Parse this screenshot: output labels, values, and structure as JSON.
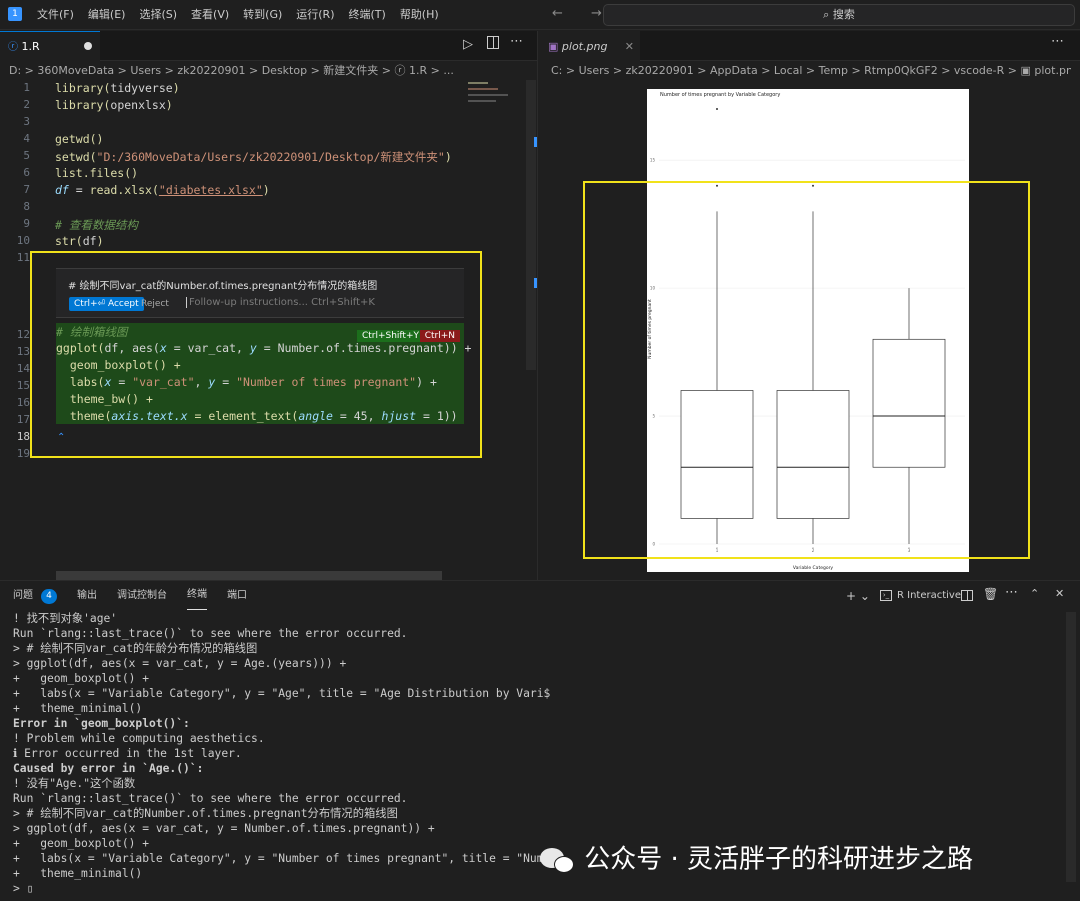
{
  "titlebar": {
    "logo": "1",
    "menu": [
      "文件(F)",
      "编辑(E)",
      "选择(S)",
      "查看(V)",
      "转到(G)",
      "运行(R)",
      "终端(T)",
      "帮助(H)"
    ],
    "nav": "← →",
    "search": "⌕ 搜索"
  },
  "editor": {
    "tab_label": "1.R",
    "breadcrumb": "D: > 360MoveData > Users > zk20220901 > Desktop > 新建文件夹 > ⓡ 1.R > ...",
    "line_numbers": [
      "1",
      "2",
      "3",
      "4",
      "5",
      "6",
      "7",
      "8",
      "9",
      "10",
      "11",
      "12",
      "13",
      "14",
      "15",
      "16",
      "17",
      "18",
      "19"
    ],
    "lines": {
      "l1a": "library(",
      "l1b": "tidyverse",
      "l1c": ")",
      "l2a": "library(",
      "l2b": "openxlsx",
      "l2c": ")",
      "l4": "getwd()",
      "l5a": "setwd(",
      "l5b": "\"D:/360MoveData/Users/zk20220901/Desktop/新建文件夹\"",
      "l5c": ")",
      "l6": "list.files()",
      "l7a": "df",
      "l7b": " = ",
      "l7c": "read.xlsx(",
      "l7d": "\"diabetes.xlsx\"",
      "l7e": ")",
      "l9": "# 查看数据结构",
      "l10a": "str(",
      "l10b": "df",
      "l10c": ")"
    },
    "chat": {
      "prompt": "# 绘制不同var_cat的Number.of.times.pregnant分布情况的箱线图",
      "accept": "Ctrl+⏎ Accept",
      "reject": "Reject",
      "followup": "Follow-up instructions... Ctrl+Shift+K",
      "accept_key": "Ctrl+Shift+Y",
      "reject_key": "Ctrl+N"
    },
    "diff_lines": {
      "d1": "# 绘制箱线图",
      "d2a": "ggplot(",
      "d2b": "df, aes(",
      "d2c": "x",
      "d2d": " = var_cat, ",
      "d2e": "y",
      "d2f": " = Number.of.times.pregnant)) +",
      "d3": "  geom_boxplot() +",
      "d4a": "  labs(",
      "d4b": "x",
      "d4c": " = ",
      "d4d": "\"var_cat\"",
      "d4e": ", ",
      "d4f": "y",
      "d4g": " = ",
      "d4h": "\"Number of times pregnant\"",
      "d4i": ") +",
      "d5": "  theme_bw() +",
      "d6a": "  theme(",
      "d6b": "axis.text.x",
      "d6c": " = element_text(",
      "d6d": "angle",
      "d6e": " = 45, ",
      "d6f": "hjust",
      "d6g": " = 1))"
    }
  },
  "plot_tab": {
    "label": "plot.png",
    "breadcrumb": "C: > Users > zk20220901 > AppData > Local > Temp > Rtmp0QkGF2 > vscode-R > ▣ plot.png",
    "title": "Number of times pregnant by Variable Category",
    "xlabel": "Variable Category",
    "ylabel": "Number of times pregnant",
    "yticks": [
      "15",
      "10",
      "5",
      "0"
    ],
    "xticks": [
      "1",
      "2",
      "3"
    ]
  },
  "chart_data": {
    "type": "boxplot",
    "title": "Number of times pregnant by Variable Category",
    "xlabel": "Variable Category",
    "ylabel": "Number of times pregnant",
    "categories": [
      "1",
      "2",
      "3"
    ],
    "boxes": [
      {
        "min": 0,
        "q1": 1,
        "median": 3,
        "q3": 6,
        "max": 13,
        "outliers": [
          14,
          17
        ]
      },
      {
        "min": 0,
        "q1": 1,
        "median": 3,
        "q3": 6,
        "max": 13,
        "outliers": [
          14
        ]
      },
      {
        "min": 0,
        "q1": 3,
        "median": 5,
        "q3": 8,
        "max": 10,
        "outliers": []
      }
    ],
    "ylim": [
      0,
      17
    ]
  },
  "panel": {
    "tabs": [
      "问题",
      "输出",
      "调试控制台",
      "终端",
      "端口"
    ],
    "problems_count": "4",
    "terminal_name": "R Interactive",
    "controls": "+ ⌄"
  },
  "terminal": [
    {
      "cls": "warn",
      "t": "! 找不到对象'age'"
    },
    {
      "cls": "grey",
      "t": "Run `rlang::last_trace()` to see where the error occurred."
    },
    {
      "cls": "",
      "t": "> # 绘制不同var_cat的年龄分布情况的箱线图"
    },
    {
      "cls": "",
      "t": "> ggplot(df, aes(x = var_cat, y = Age.(years))) +"
    },
    {
      "cls": "",
      "t": "+   geom_boxplot() +"
    },
    {
      "cls": "",
      "t": "+   labs(x = \"Variable Category\", y = \"Age\", title = \"Age Distribution by Vari$"
    },
    {
      "cls": "",
      "t": "+   theme_minimal()"
    },
    {
      "cls": "bold",
      "t": "Error in `geom_boxplot()`:"
    },
    {
      "cls": "warn",
      "t": "! Problem while computing aesthetics."
    },
    {
      "cls": "blue",
      "t": "ℹ Error occurred in the 1st layer."
    },
    {
      "cls": "bold",
      "t": "Caused by error in `Age.()`:"
    },
    {
      "cls": "warn",
      "t": "! 没有\"Age.\"这个函数"
    },
    {
      "cls": "grey",
      "t": "Run `rlang::last_trace()` to see where the error occurred."
    },
    {
      "cls": "",
      "t": "> # 绘制不同var_cat的Number.of.times.pregnant分布情况的箱线图"
    },
    {
      "cls": "",
      "t": "> ggplot(df, aes(x = var_cat, y = Number.of.times.pregnant)) +"
    },
    {
      "cls": "",
      "t": "+   geom_boxplot() +"
    },
    {
      "cls": "",
      "t": "+   labs(x = \"Variable Category\", y = \"Number of times pregnant\", title = \"Num$"
    },
    {
      "cls": "",
      "t": "+   theme_minimal()"
    },
    {
      "cls": "",
      "t": "> ▯"
    }
  ],
  "watermark": "公众号 · 灵活胖子的科研进步之路"
}
